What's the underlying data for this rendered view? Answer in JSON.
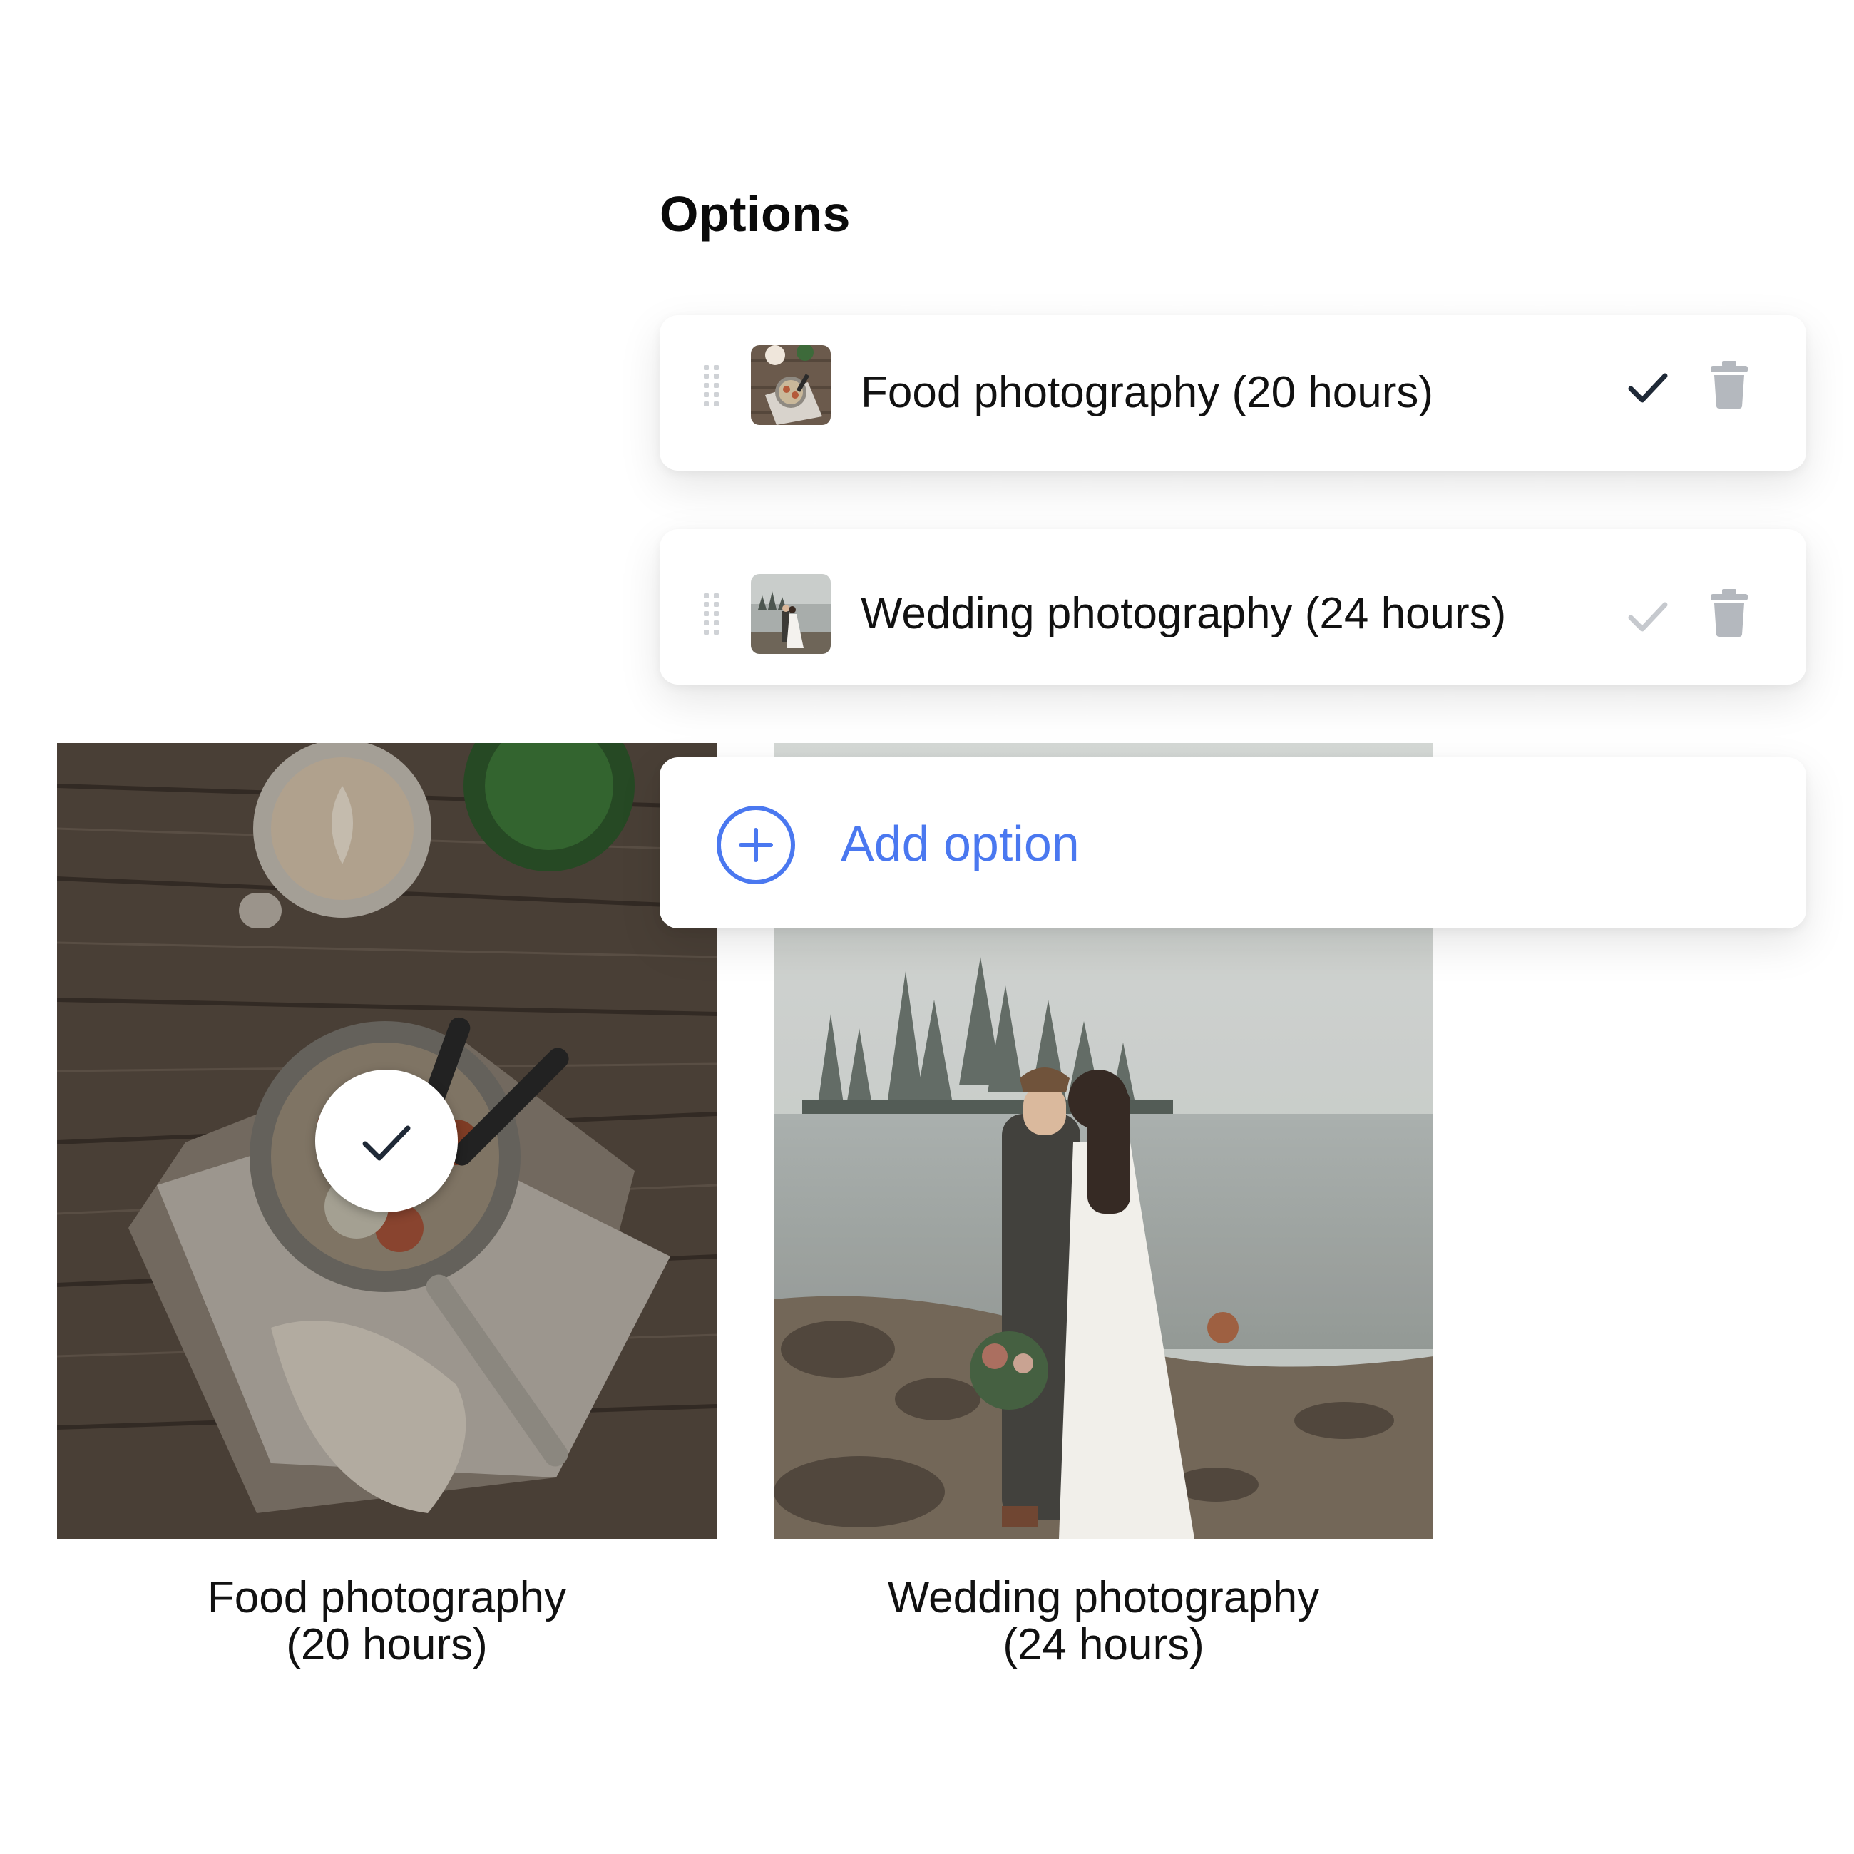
{
  "section": {
    "title": "Options"
  },
  "options": [
    {
      "label": "Food photography (20 hours)",
      "thumbnail_icon": "food-thumbnail",
      "selected": true,
      "check_color": "#1f2937"
    },
    {
      "label": "Wedding photography (24 hours)",
      "thumbnail_icon": "wedding-thumbnail",
      "selected": false,
      "check_color": "#c6c9ce"
    }
  ],
  "add_option": {
    "label": "Add option",
    "icon": "plus-circle-icon",
    "color": "#4a78f0"
  },
  "previews": [
    {
      "line1": "Food photography",
      "line2": "(20 hours)",
      "selected": true
    },
    {
      "line1": "Wedding photography",
      "line2": "(24 hours)",
      "selected": false
    }
  ],
  "colors": {
    "accent": "#4a78f0",
    "icon_gray": "#b4b8be",
    "text": "#111111"
  }
}
